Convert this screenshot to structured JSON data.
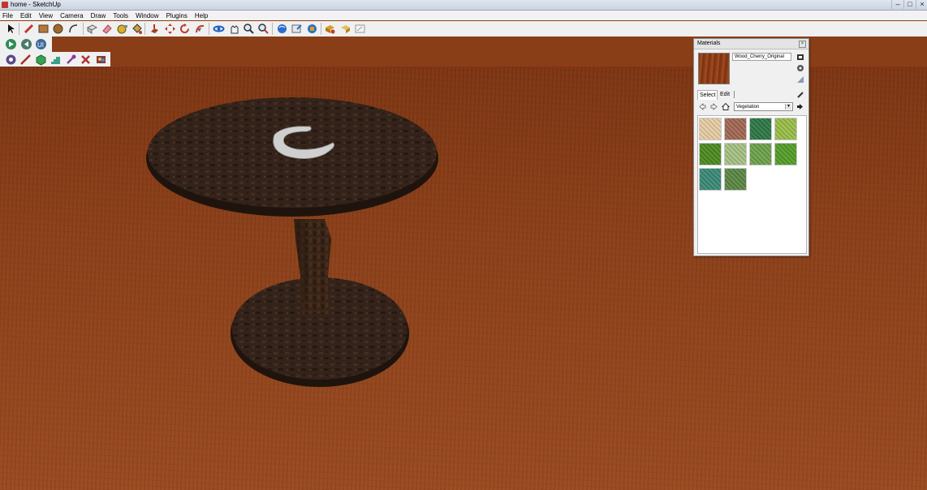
{
  "window": {
    "title": "home - SketchUp",
    "controls": [
      "minimize",
      "maximize",
      "close"
    ]
  },
  "menu": [
    "File",
    "Edit",
    "View",
    "Camera",
    "Draw",
    "Tools",
    "Window",
    "Plugins",
    "Help"
  ],
  "toolbar1": [
    "select-tool",
    "pencil-tool",
    "rectangle-tool",
    "circle-tool",
    "arc-tool",
    "make-component-tool",
    "eraser-tool",
    "tape-measure-tool",
    "paint-bucket-tool",
    "push-pull-tool",
    "move-tool",
    "rotate-tool",
    "follow-me-tool",
    "orbit-tool",
    "pan-tool",
    "zoom-tool",
    "zoom-extents-tool",
    "get-models-tool",
    "share-model-tool",
    "share-component-tool",
    "extension-warehouse-tool",
    "layout-tool",
    "send-to-layout-tool"
  ],
  "toolbar2": [
    "play-icon",
    "previous-scene-icon",
    "ui-icon"
  ],
  "toolbar3": [
    "sandbox-icon",
    "line-icon",
    "cube-icon",
    "stairs-icon",
    "wrench-icon",
    "cross-icon",
    "bricks-icon"
  ],
  "materials": {
    "title": "Materials",
    "current_name": "Wood_Cherry_Original",
    "tabs": [
      "Select",
      "Edit"
    ],
    "library": "Vegetation",
    "swatches": [
      {
        "name": "swatch-sand",
        "color": "#e9cfa6"
      },
      {
        "name": "swatch-gravel",
        "color": "#a46a55"
      },
      {
        "name": "swatch-ivy",
        "color": "#2f7a48"
      },
      {
        "name": "swatch-moss-light",
        "color": "#9cc04a"
      },
      {
        "name": "swatch-grass-dark",
        "color": "#4f8c22"
      },
      {
        "name": "swatch-grass-pale",
        "color": "#a8c486"
      },
      {
        "name": "swatch-grass-mid",
        "color": "#6fa44e"
      },
      {
        "name": "swatch-grass-bright",
        "color": "#56a02a"
      },
      {
        "name": "swatch-water-plants",
        "color": "#3c8c7a"
      },
      {
        "name": "swatch-shrub",
        "color": "#5c8a45"
      }
    ]
  },
  "scene": {
    "floor_color": "#8c4019",
    "table_color": "#2e1e14",
    "object_color": "#c8c8c8"
  }
}
